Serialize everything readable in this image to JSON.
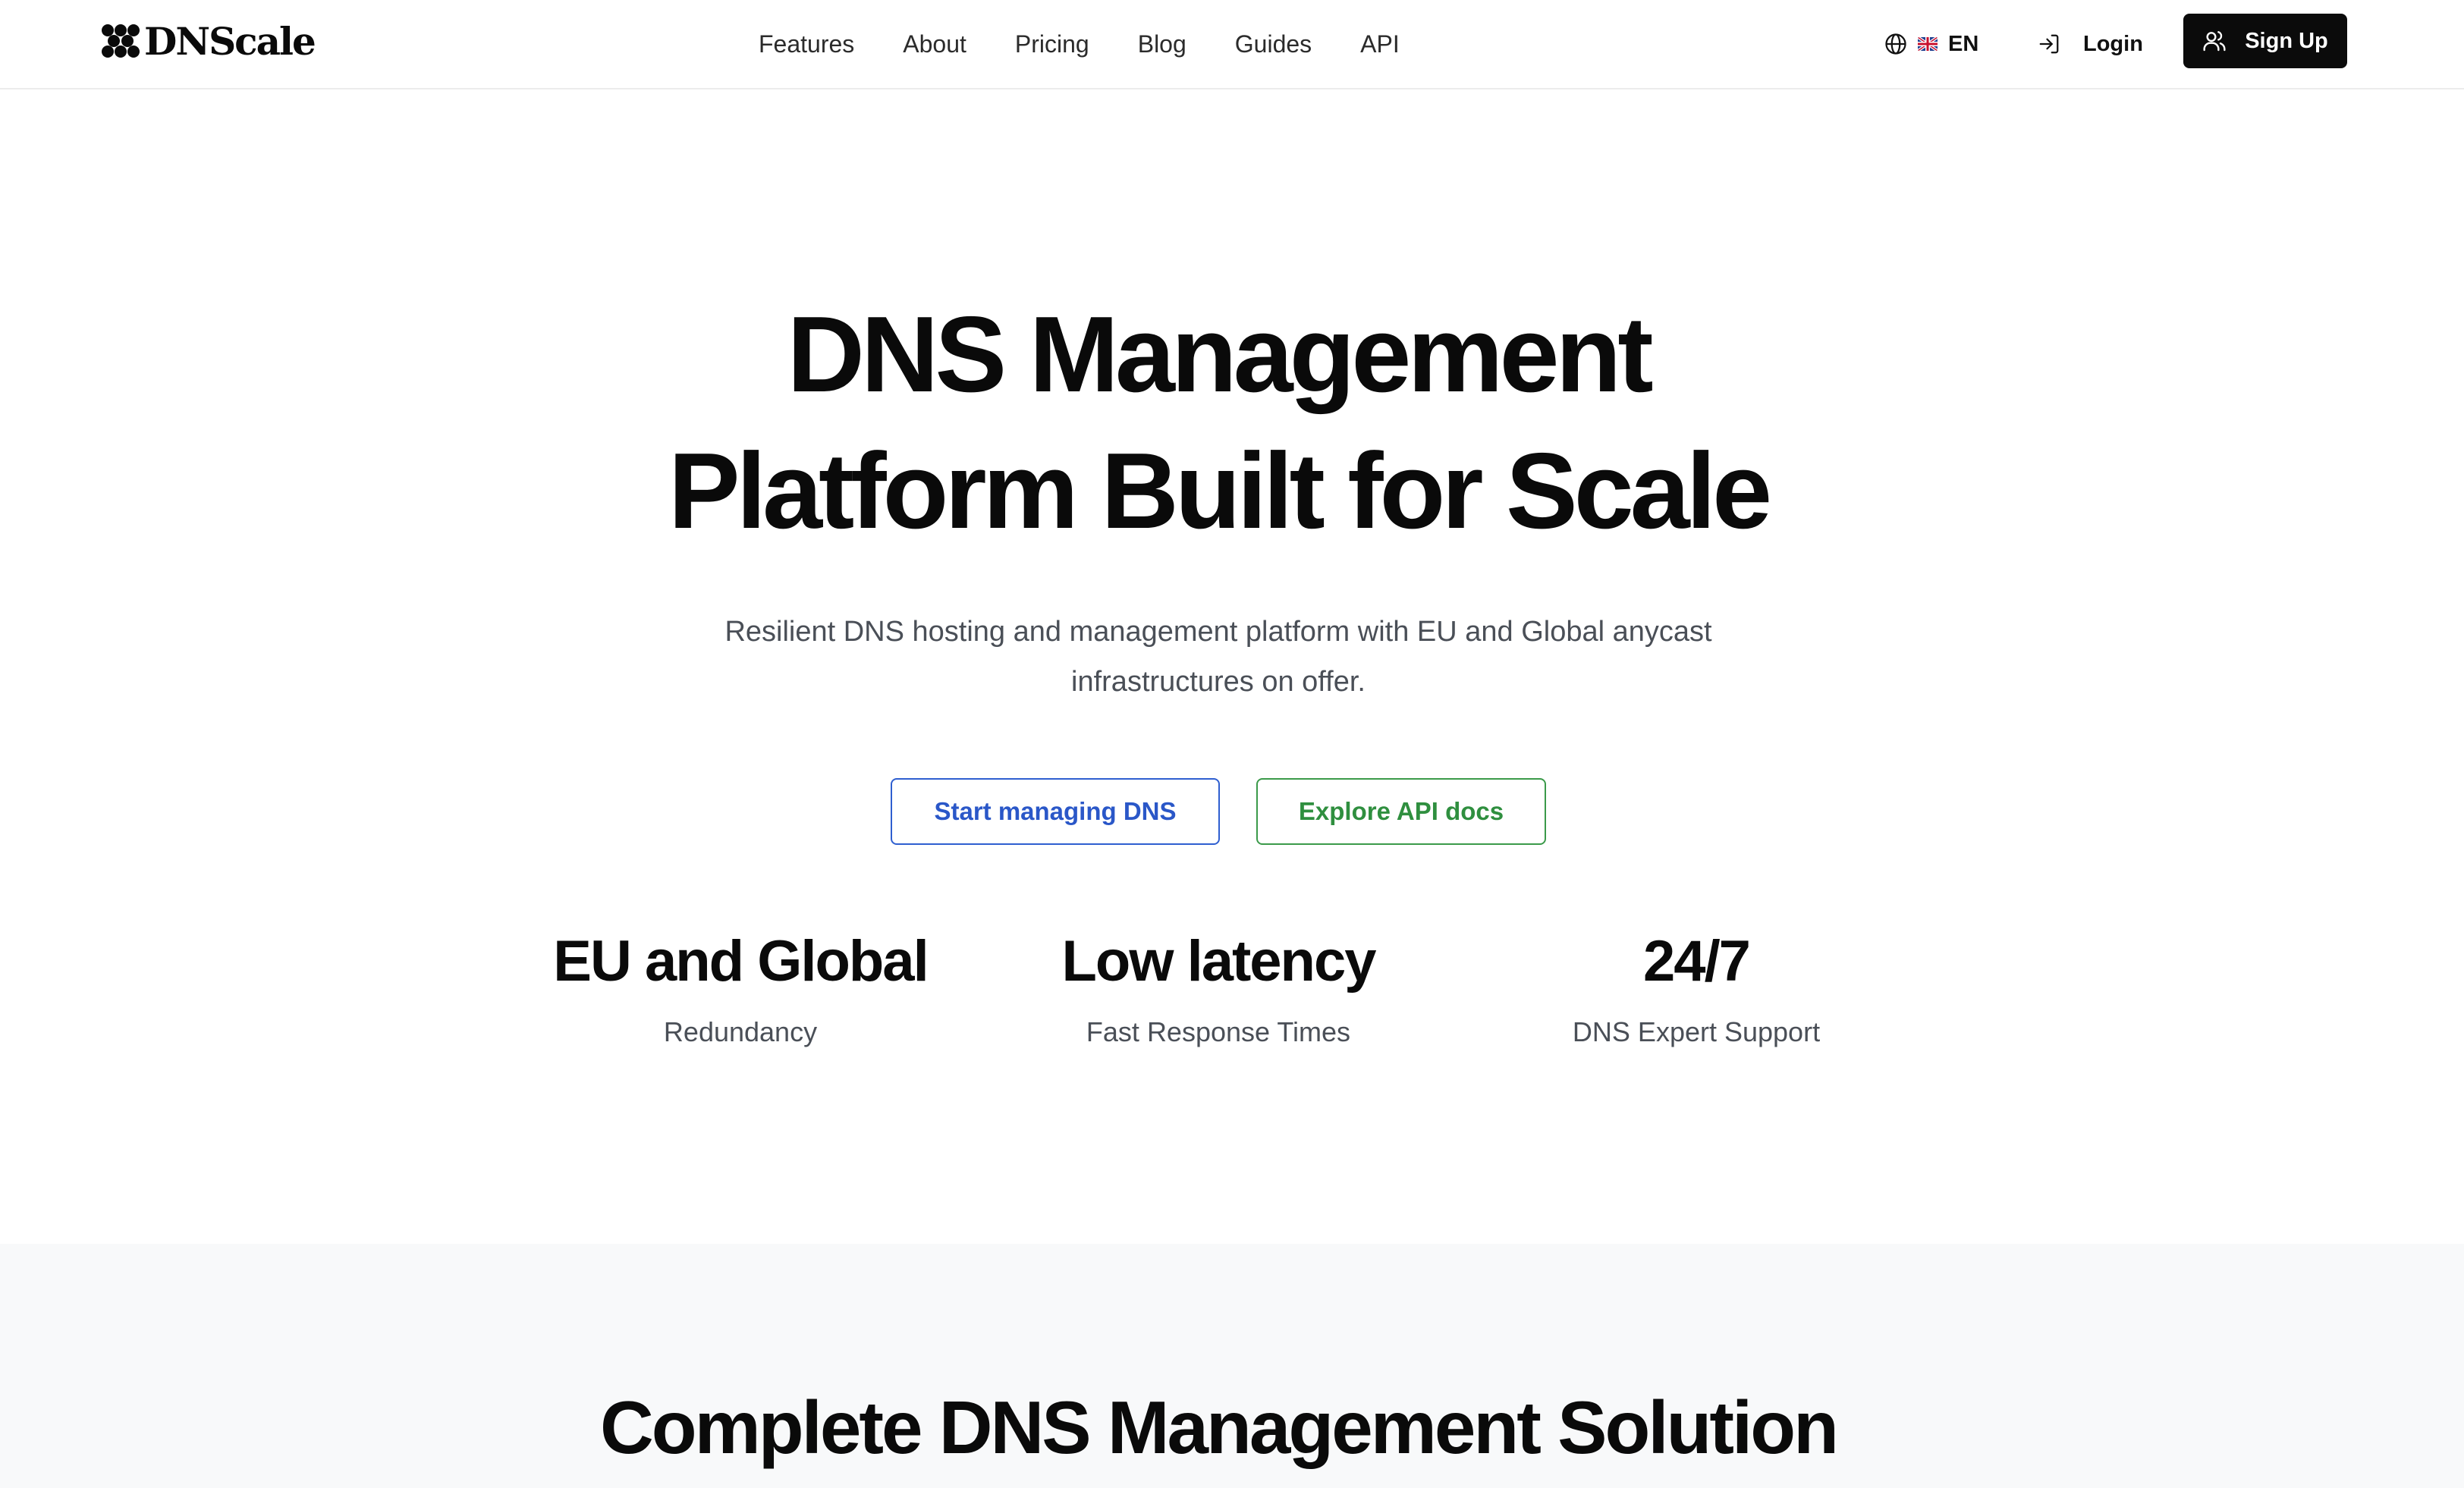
{
  "brand": {
    "name": "DNScale",
    "icon": "dnscale-logo-icon"
  },
  "nav": {
    "items": [
      {
        "label": "Features"
      },
      {
        "label": "About"
      },
      {
        "label": "Pricing"
      },
      {
        "label": "Blog"
      },
      {
        "label": "Guides"
      },
      {
        "label": "API"
      }
    ]
  },
  "language": {
    "code": "EN",
    "icon": "globe-icon",
    "flag": "uk-flag-icon"
  },
  "auth": {
    "login_label": "Login",
    "login_icon": "login-icon",
    "signup_label": "Sign Up",
    "signup_icon": "users-icon"
  },
  "hero": {
    "title_line1": "DNS Management",
    "title_line2": "Platform Built for Scale",
    "subtitle_line1": "Resilient DNS hosting and management platform with EU and Global anycast",
    "subtitle_line2": "infrastructures on offer.",
    "primary_cta": "Start managing DNS",
    "secondary_cta": "Explore API docs"
  },
  "stats": [
    {
      "value": "EU and Global",
      "label": "Redundancy"
    },
    {
      "value": "Low latency",
      "label": "Fast Response Times"
    },
    {
      "value": "24/7",
      "label": "DNS Expert Support"
    }
  ],
  "section": {
    "title": "Complete DNS Management Solution"
  },
  "colors": {
    "primary_blue": "#2a57c8",
    "secondary_green": "#2f8f3f",
    "dark": "#0b0b0b",
    "section_bg": "#f8f9fa"
  }
}
